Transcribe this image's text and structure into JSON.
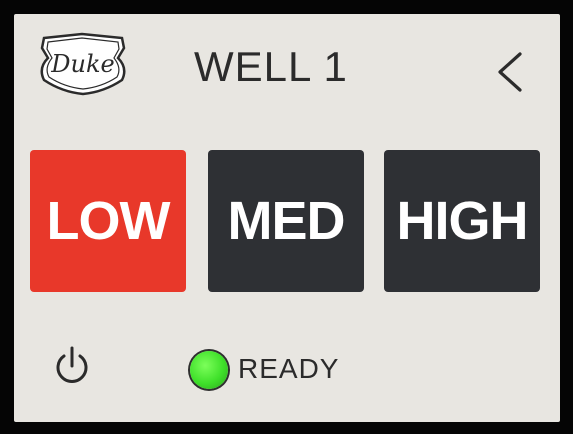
{
  "header": {
    "title": "WELL 1",
    "logo_text": "Duke",
    "back_icon": "chevron-left-icon"
  },
  "modes": [
    {
      "label": "LOW",
      "selected": true,
      "color": "#e8382a"
    },
    {
      "label": "MED",
      "selected": false,
      "color": "#2e3034"
    },
    {
      "label": "HIGH",
      "selected": false,
      "color": "#2e3034"
    }
  ],
  "footer": {
    "power_icon": "power-icon",
    "status_label": "READY",
    "status_color": "#3fe02a"
  }
}
